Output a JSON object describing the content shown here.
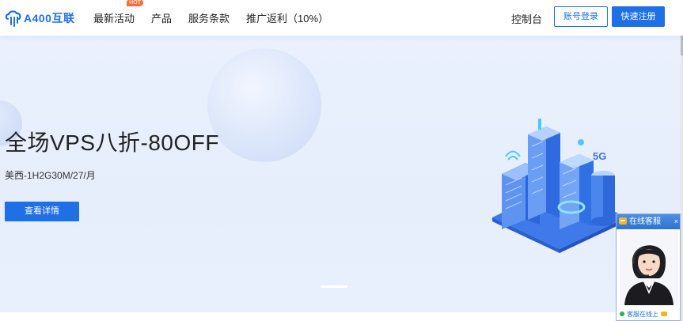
{
  "header": {
    "logo_text": "A400互联",
    "nav": [
      {
        "label": "最新活动",
        "badge": "HOT"
      },
      {
        "label": "产品"
      },
      {
        "label": "服务条款"
      },
      {
        "label": "推广返利（10%）"
      }
    ],
    "console_label": "控制台",
    "login_label": "账号登录",
    "register_label": "快速注册"
  },
  "hero": {
    "title": "全场VPS八折-80OFF",
    "subtitle": "美西-1H2G30M/27/月",
    "button_label": "查看详情",
    "illustration_badge": "5G"
  },
  "chat": {
    "title": "在线客服",
    "close_label": "×",
    "status": "客服在线上"
  },
  "colors": {
    "accent": "#1f6fe6",
    "hot_badge": "#ff6a3d",
    "hero_bg": "#e8effd"
  },
  "icons": {
    "logo": "cloud-logo-icon",
    "chat": "chat-bubble-icon",
    "close": "close-icon"
  }
}
